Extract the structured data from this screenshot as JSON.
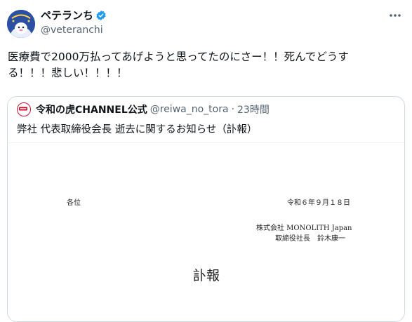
{
  "tweet": {
    "display_name": "ペテランち",
    "handle": "@veteranchi",
    "text_line1": "医療費で2000万払ってあげようと思ってたのにさー！！死んでどうす",
    "text_line2": "る！！！悲しい！！！！",
    "more_icon": "more-icon"
  },
  "quote": {
    "account_name": "令和の虎CHANNEL公式",
    "account_handle": "@reiwa_no_tora",
    "separator": "·",
    "time": "23時間",
    "text": "弊社 代表取締役会長 逝去に関するお知らせ（訃報）"
  },
  "document": {
    "addressee": "各位",
    "date": "令和６年９月１８日",
    "company": "株式会社 MONOLITH Japan",
    "signer": "取締役社長　鈴木康一",
    "title": "訃報"
  },
  "colors": {
    "verified": "#1d9bf0",
    "muted": "#536471",
    "border": "#cfd9de",
    "avatar_bg": "#2b4fa3",
    "quote_logo": "#c8102e"
  }
}
